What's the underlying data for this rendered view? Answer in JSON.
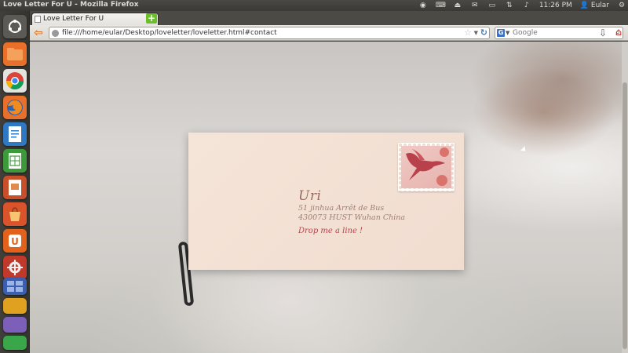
{
  "window": {
    "title": "Love Letter For U - Mozilla Firefox"
  },
  "panel": {
    "time": "11:26 PM",
    "user": "Eular"
  },
  "tabs": [
    {
      "label": "Love Letter For U"
    }
  ],
  "navbar": {
    "url": "file:///home/eular/Desktop/loveletter/loveletter.html#contact",
    "search_placeholder": "Google",
    "search_engine": "G"
  },
  "launcher": {
    "items": [
      "dash-home-icon",
      "files-icon",
      "chrome-icon",
      "firefox-icon",
      "writer-icon",
      "calc-icon",
      "impress-icon",
      "software-center-icon",
      "ubuntu-one-icon",
      "settings-icon",
      "workspace-icon",
      "app-icon",
      "app-icon",
      "app-icon"
    ]
  },
  "letter": {
    "name": "Uri",
    "address_line1": "51 jinhua Arrêt de Bus",
    "address_line2": "430073 HUST Wuhan China",
    "cta": "Drop me a line !"
  },
  "colors": {
    "accent": "#b3444b",
    "stamp_art": "#e7b3ae",
    "ubuntu_orange": "#dd4814"
  }
}
